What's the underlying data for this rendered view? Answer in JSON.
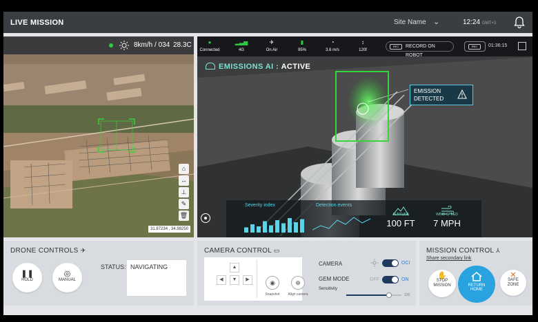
{
  "header": {
    "title": "LIVE MISSION",
    "site": "Site Name",
    "time": "12:24",
    "tz": "GMT+3"
  },
  "map": {
    "wind": "8km/h / 034",
    "temp": "28.3C",
    "coords": "31.87234 , 34.98250"
  },
  "camera_bar": {
    "stats": [
      {
        "icon": "●",
        "label": "Connected"
      },
      {
        "icon": "▂▃▅",
        "label": "4G"
      },
      {
        "icon": "✈",
        "label": "On Air"
      },
      {
        "icon": "▮",
        "label": "95%"
      },
      {
        "icon": "◔",
        "label": "3.6 m/s"
      },
      {
        "icon": "↕",
        "label": "120f"
      }
    ],
    "record_label": "RECORD ON ROBOT",
    "rec_tag": "REC",
    "rec_time": "01:36:15"
  },
  "overlay": {
    "emissions_prefix": "EMISSIONS AI :",
    "emissions_state": "ACTIVE",
    "emission_line1": "EMISSION",
    "emission_line2": "DETECTED",
    "severity_label": "Severity index",
    "detection_label": "Detection events",
    "altitude_label": "ALTITUDE",
    "altitude_value": "100 FT",
    "wind_label": "WIND SPEED",
    "wind_value": "7 MPH",
    "severity_bars": [
      0.25,
      0.4,
      0.3,
      0.55,
      0.35,
      0.6,
      0.45,
      0.7,
      0.5,
      0.65
    ]
  },
  "drone": {
    "title": "DRONE CONTROLS",
    "hold": "HOLD",
    "manual": "MANUAL",
    "status_label": "STATUS:",
    "status_value": "NAVIGATING"
  },
  "camera_control": {
    "title": "CAMERA CONTROL",
    "snapshot": "Snapshot",
    "align": "Align camera",
    "camera_label": "CAMERA",
    "camera_state": "OCI",
    "gem_label": "GEM MODE",
    "gem_off": "OFF",
    "gem_on": "ON",
    "sensitivity_label": "Sensitivity",
    "sensitivity_max": "120",
    "sensitivity_fraction": 0.78
  },
  "mission": {
    "title": "MISSION CONTROL",
    "link": "Share secondary link",
    "stop_line1": "STOP",
    "stop_line2": "MISSION",
    "return_line1": "RETURN",
    "return_line2": "HOME",
    "safe_line1": "SAFE",
    "safe_line2": "ZONE"
  },
  "colors": {
    "accent": "#29a3e0",
    "detect": "#37d43c",
    "ai_text": "#7fe0cf"
  }
}
